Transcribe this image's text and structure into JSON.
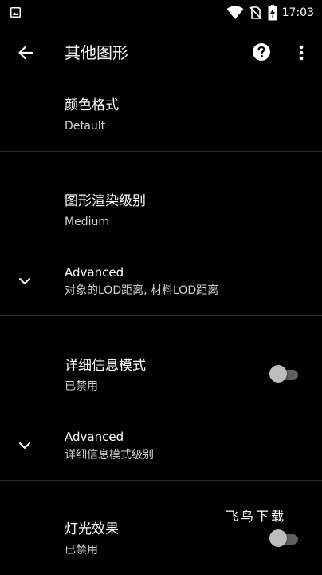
{
  "status_bar": {
    "time": "17:03",
    "icons": [
      "gallery-icon",
      "wifi-icon",
      "no-sim-icon",
      "battery-charging-icon"
    ]
  },
  "app_bar": {
    "title": "其他图形",
    "icons": [
      "back-arrow-icon",
      "help-icon",
      "more-vert-icon"
    ]
  },
  "settings": {
    "color_format": {
      "title": "颜色格式",
      "summary": "Default"
    },
    "render_level": {
      "title": "图形渲染级别",
      "summary": "Medium"
    },
    "advanced_1": {
      "title": "Advanced",
      "summary": "对象的LOD距离, 材料LOD距离"
    },
    "detail_mode": {
      "title": "详细信息模式",
      "summary": "已禁用",
      "enabled": false
    },
    "advanced_2": {
      "title": "Advanced",
      "summary": "详细信息模式级别"
    },
    "light_effect": {
      "title": "灯光效果",
      "summary": "已禁用",
      "enabled": false
    }
  },
  "watermark": {
    "text": "飞鸟下载"
  },
  "colors": {
    "background": "#000000",
    "text_primary": "#ffffff",
    "text_secondary": "#d2d2d2",
    "divider": "#2a2a2a",
    "switch_track_off": "#5f5f5f",
    "switch_thumb_off": "#bdbdbd"
  }
}
